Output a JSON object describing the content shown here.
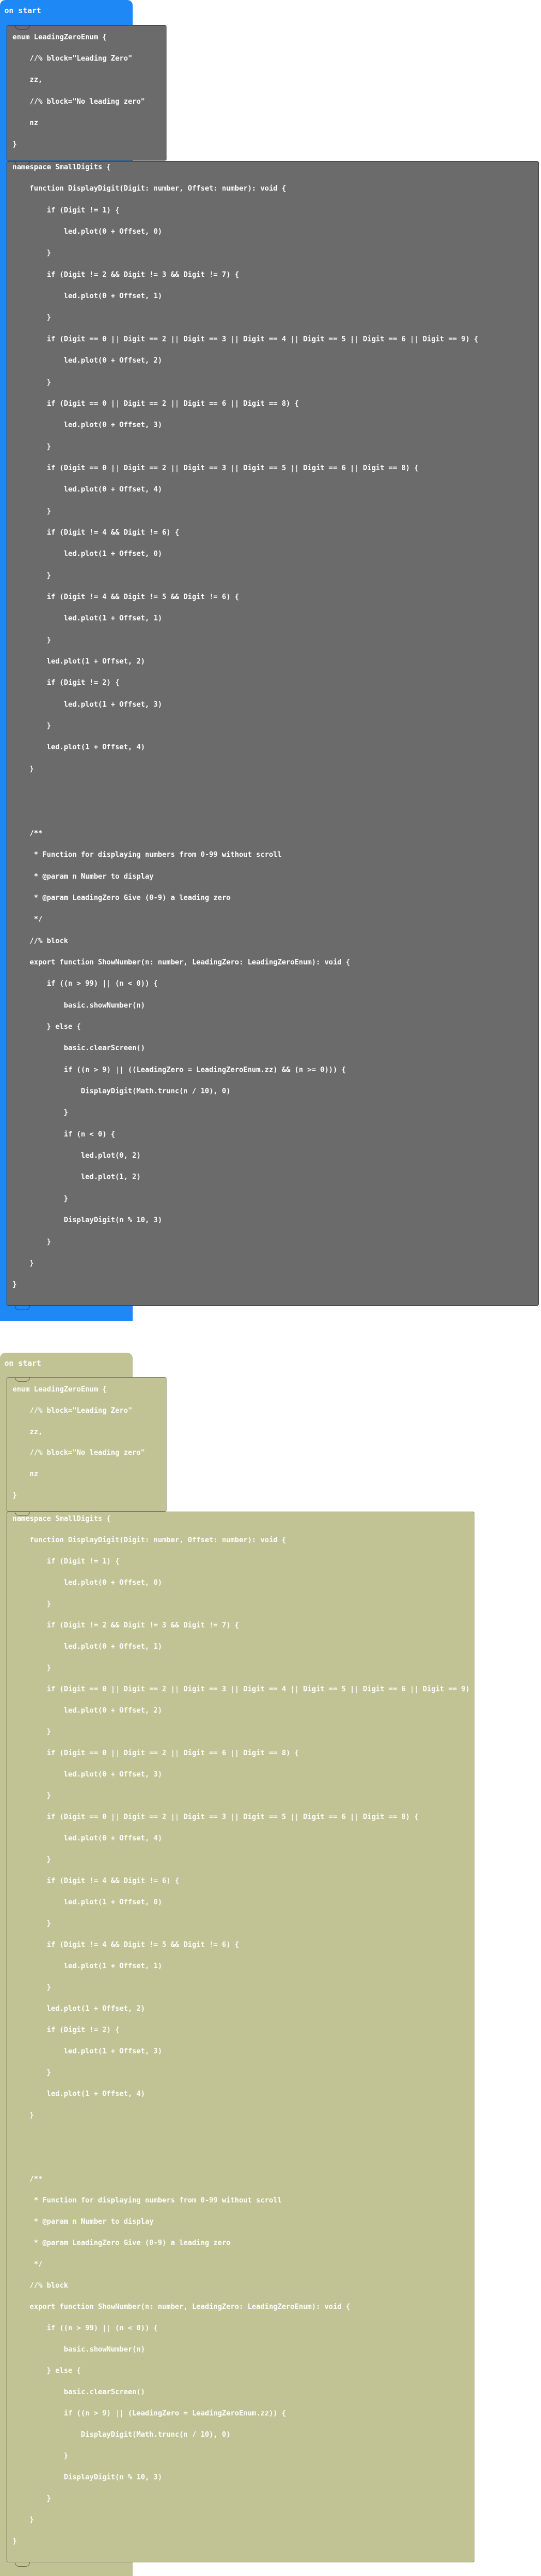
{
  "colors": {
    "hat_blue": "#1e88f5",
    "hat_olive": "#c1c395",
    "block_gray": "#6b6b6b",
    "block_olive": "#c1c395",
    "text": "#ffffff"
  },
  "stacks": [
    {
      "hat_label": "on start",
      "enum_block": [
        "enum LeadingZeroEnum {",
        "    //% block=\"Leading Zero\"",
        "    zz,",
        "    //% block=\"No leading zero\"",
        "    nz",
        "}"
      ],
      "ns_block": [
        "namespace SmallDigits {",
        "    function DisplayDigit(Digit: number, Offset: number): void {",
        "        if (Digit != 1) {",
        "            led.plot(0 + Offset, 0)",
        "        }",
        "        if (Digit != 2 && Digit != 3 && Digit != 7) {",
        "            led.plot(0 + Offset, 1)",
        "        }",
        "        if (Digit == 0 || Digit == 2 || Digit == 3 || Digit == 4 || Digit == 5 || Digit == 6 || Digit == 9) {",
        "            led.plot(0 + Offset, 2)",
        "        }",
        "        if (Digit == 0 || Digit == 2 || Digit == 6 || Digit == 8) {",
        "            led.plot(0 + Offset, 3)",
        "        }",
        "        if (Digit == 0 || Digit == 2 || Digit == 3 || Digit == 5 || Digit == 6 || Digit == 8) {",
        "            led.plot(0 + Offset, 4)",
        "        }",
        "        if (Digit != 4 && Digit != 6) {",
        "            led.plot(1 + Offset, 0)",
        "        }",
        "        if (Digit != 4 && Digit != 5 && Digit != 6) {",
        "            led.plot(1 + Offset, 1)",
        "        }",
        "        led.plot(1 + Offset, 2)",
        "        if (Digit != 2) {",
        "            led.plot(1 + Offset, 3)",
        "        }",
        "        led.plot(1 + Offset, 4)",
        "    }",
        "",
        "",
        "    /**",
        "     * Function for displaying numbers from 0-99 without scroll",
        "     * @param n Number to display",
        "     * @param LeadingZero Give (0-9) a leading zero",
        "     */",
        "    //% block",
        "    export function ShowNumber(n: number, LeadingZero: LeadingZeroEnum): void {",
        "        if ((n > 99) || (n < 0)) {",
        "            basic.showNumber(n)",
        "        } else {",
        "            basic.clearScreen()",
        "            if ((n > 9) || ((LeadingZero = LeadingZeroEnum.zz) && (n >= 0))) {",
        "                DisplayDigit(Math.trunc(n / 10), 0)",
        "            }",
        "            if (n < 0) {",
        "                led.plot(0, 2)",
        "                led.plot(1, 2)",
        "            }",
        "            DisplayDigit(n % 10, 3)",
        "        }",
        "    }",
        "}"
      ]
    },
    {
      "hat_label": "on start",
      "enum_block": [
        "enum LeadingZeroEnum {",
        "    //% block=\"Leading Zero\"",
        "    zz,",
        "    //% block=\"No leading zero\"",
        "    nz",
        "}"
      ],
      "ns_block": [
        "namespace SmallDigits {",
        "    function DisplayDigit(Digit: number, Offset: number): void {",
        "        if (Digit != 1) {",
        "            led.plot(0 + Offset, 0)",
        "        }",
        "        if (Digit != 2 && Digit != 3 && Digit != 7) {",
        "            led.plot(0 + Offset, 1)",
        "        }",
        "        if (Digit == 0 || Digit == 2 || Digit == 3 || Digit == 4 || Digit == 5 || Digit == 6 || Digit == 9) {",
        "            led.plot(0 + Offset, 2)",
        "        }",
        "        if (Digit == 0 || Digit == 2 || Digit == 6 || Digit == 8) {",
        "            led.plot(0 + Offset, 3)",
        "        }",
        "        if (Digit == 0 || Digit == 2 || Digit == 3 || Digit == 5 || Digit == 6 || Digit == 8) {",
        "            led.plot(0 + Offset, 4)",
        "        }",
        "        if (Digit != 4 && Digit != 6) {",
        "            led.plot(1 + Offset, 0)",
        "        }",
        "        if (Digit != 4 && Digit != 5 && Digit != 6) {",
        "            led.plot(1 + Offset, 1)",
        "        }",
        "        led.plot(1 + Offset, 2)",
        "        if (Digit != 2) {",
        "            led.plot(1 + Offset, 3)",
        "        }",
        "        led.plot(1 + Offset, 4)",
        "    }",
        "",
        "",
        "    /**",
        "     * Function for displaying numbers from 0-99 without scroll",
        "     * @param n Number to display",
        "     * @param LeadingZero Give (0-9) a leading zero",
        "     */",
        "    //% block",
        "    export function ShowNumber(n: number, LeadingZero: LeadingZeroEnum): void {",
        "        if ((n > 99) || (n < 0)) {",
        "            basic.showNumber(n)",
        "        } else {",
        "            basic.clearScreen()",
        "            if ((n > 9) || (LeadingZero = LeadingZeroEnum.zz)) {",
        "                DisplayDigit(Math.trunc(n / 10), 0)",
        "            }",
        "            DisplayDigit(n % 10, 3)",
        "        }",
        "    }",
        "}"
      ]
    }
  ]
}
